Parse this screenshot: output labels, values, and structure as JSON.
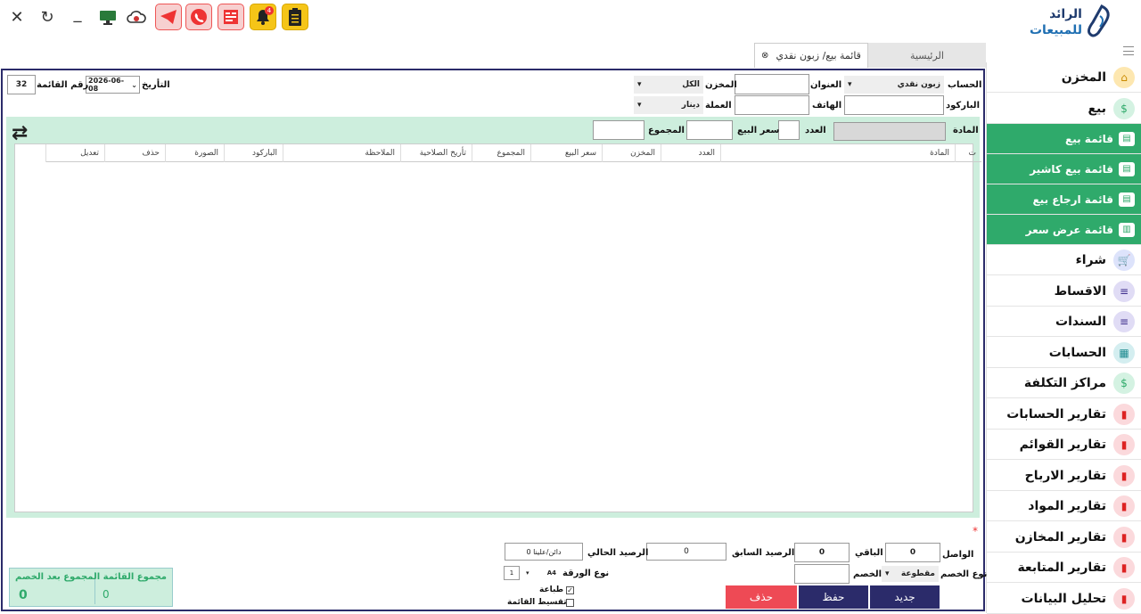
{
  "window": {
    "close": "✕",
    "refresh": "↻",
    "minimize": "_"
  },
  "toolbar": {
    "notif_count": "4"
  },
  "logo": {
    "line1": "الرائد",
    "line2": "للمبيعات"
  },
  "tabs": {
    "home": "الرئيسية",
    "active": "قائمة بيع/ زبون نقدي",
    "active_close": "⊗"
  },
  "sidebar": {
    "items": [
      {
        "label": "المخزن"
      },
      {
        "label": "بيع"
      },
      {
        "label": "قائمة بيع"
      },
      {
        "label": "قائمة بيع كاشير"
      },
      {
        "label": "قائمة ارجاع بيع"
      },
      {
        "label": "قائمة عرض سعر"
      },
      {
        "label": "شراء"
      },
      {
        "label": "الاقساط"
      },
      {
        "label": "السندات"
      },
      {
        "label": "الحسابات"
      },
      {
        "label": "مراكز التكلفة"
      },
      {
        "label": "تقارير الحسابات"
      },
      {
        "label": "تقارير القوائم"
      },
      {
        "label": "تقارير الارباح"
      },
      {
        "label": "تقارير المواد"
      },
      {
        "label": "تقارير المخازن"
      },
      {
        "label": "تقارير المتابعة"
      },
      {
        "label": "تحليل البيانات"
      }
    ]
  },
  "form": {
    "account_label": "الحساب",
    "account_value": "زبون نقدي",
    "address_label": "العنوان",
    "store_label": "المخزن",
    "store_value": "الكل",
    "barcode_label": "الباركود",
    "phone_label": "الهاتف",
    "currency_label": "العملة",
    "currency_value": "دينار",
    "date_label": "التأريخ",
    "date_value": "2026-06-08",
    "invoice_no_label": "رقم القائمة",
    "invoice_no_value": "32"
  },
  "entry": {
    "item_label": "المادة",
    "qty_label": "العدد",
    "price_label": "سعر البيع",
    "total_label": "المجموع"
  },
  "grid": {
    "columns": [
      "ت",
      "المادة",
      "العدد",
      "المخزن",
      "سعر البيع",
      "المجموع",
      "تأريخ الصلاحية",
      "الملاحظة",
      "الباركود",
      "الصورة",
      "حذف",
      "تعديل"
    ]
  },
  "footer": {
    "required_mark": "*",
    "received_label": "الواصل",
    "received_value": "0",
    "remaining_label": "الباقي",
    "remaining_value": "0",
    "prev_balance_label": "الرصيد السابق",
    "prev_balance_value": "0",
    "cur_balance_label": "الرصيد الحالي",
    "cur_balance_value": "0 دائن/علينا",
    "discount_type_label": "نوع الخصم",
    "discount_type_value": "مقطوعة",
    "discount_label": "الخصم",
    "paper_type_label": "نوع الورقة",
    "paper_value": "A4",
    "copies_value": "1",
    "print_label": "طباعة",
    "installment_label": "تقسيط القائمة",
    "new_btn": "جديد",
    "save_btn": "حفظ",
    "delete_btn": "حذف",
    "invoice_total_label": "مجموع القائمة",
    "invoice_total_value": "0",
    "total_after_discount_label": "المجموع بعد الخصم",
    "total_after_discount_value": "0"
  }
}
